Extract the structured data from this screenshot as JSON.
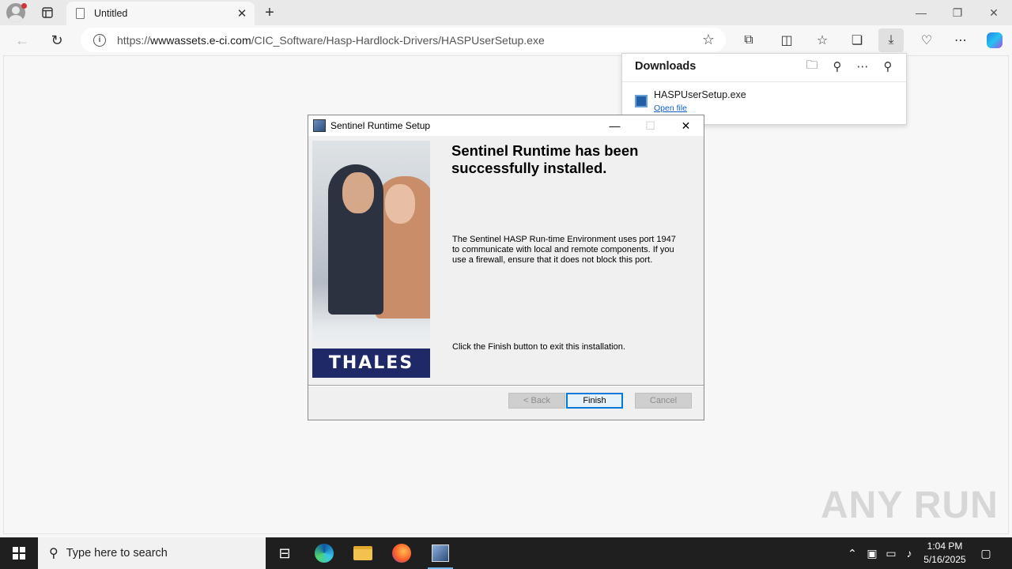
{
  "browser": {
    "tab_title": "Untitled",
    "url_prefix": "https://",
    "url_host": "wwwassets.e-ci.com",
    "url_path": "/CIC_Software/Hasp-Hardlock-Drivers/HASPUserSetup.exe"
  },
  "downloads": {
    "title": "Downloads",
    "file_name": "HASPUserSetup.exe",
    "open_label": "Open file"
  },
  "dialog": {
    "title": "Sentinel Runtime Setup",
    "heading": "Sentinel Runtime has been successfully installed.",
    "body": "The Sentinel HASP Run-time Environment uses port 1947 to communicate with local and remote components. If you use a firewall, ensure that it does not block this port.",
    "finish_text": "Click the Finish button to exit this installation.",
    "logo_text": "THALES",
    "back_label": "< Back",
    "finish_label": "Finish",
    "cancel_label": "Cancel"
  },
  "watermark": "ANY RUN",
  "taskbar": {
    "search_placeholder": "Type here to search",
    "time": "1:04 PM",
    "date": "5/16/2025"
  }
}
